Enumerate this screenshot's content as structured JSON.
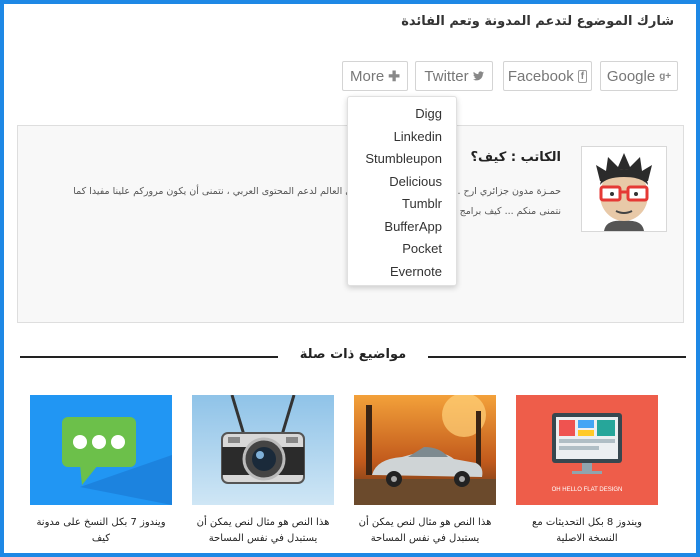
{
  "share": {
    "title": "شارك الموضوع لتدعم المدونة وتعم الفائدة",
    "buttons": {
      "google": "Google",
      "facebook": "Facebook",
      "twitter": "Twitter",
      "more": "More"
    }
  },
  "more_menu": [
    "Digg",
    "Linkedin",
    "Stumbleupon",
    "Delicious",
    "Tumblr",
    "BufferApp",
    "Pocket",
    "Evernote"
  ],
  "author": {
    "name": "الكاتب : كيف؟",
    "bio": "حمـزة  مدون جزائري ارح ... بلوجرناقلتي المفتوحة على العالم لدعم المحتوى العربي ، نتمنى أن يكون مروركم علينا مفيدا كما نتمنى منكم ... كيف برامج وبلوجر"
  },
  "related": {
    "title": "مواضيع ذات صلة",
    "posts": [
      {
        "title": "ويندوز 8 بكل التحديثات مع النسخة الاصلية",
        "thumb_caption": "OH HELLO FLAT DESIGN"
      },
      {
        "title": "هذا النص هو مثال لنص يمكن أن يستبدل في نفس المساحة"
      },
      {
        "title": "هذا النص هو مثال لنص يمكن أن يستبدل في نفس المساحة"
      },
      {
        "title": "ويندوز 7 بكل النسخ على مدونة كيف"
      }
    ]
  },
  "colors": {
    "frame_border": "#1e88e5",
    "thumb_red": "#ee5d4a",
    "thumb_blue": "#2196f3",
    "chat_green": "#6cc04a"
  }
}
